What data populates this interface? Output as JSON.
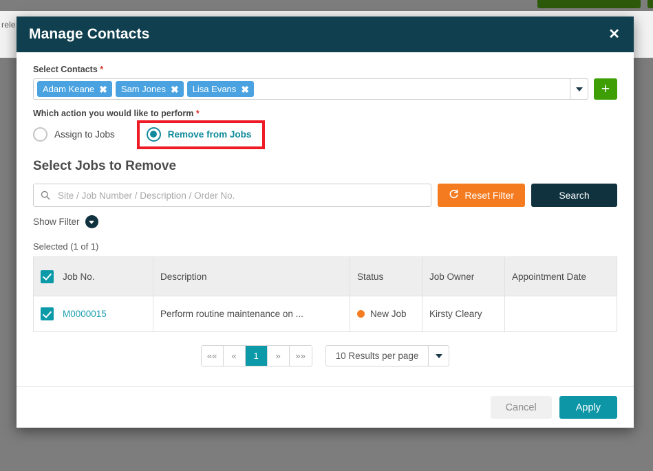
{
  "background": {
    "text_fragment": "rele",
    "green_button_color": "#2c5a0a",
    "overlay_color": "#7d7d7d"
  },
  "modal": {
    "title": "Manage Contacts",
    "header_color": "#10404f",
    "close_label": "✕"
  },
  "contacts": {
    "label": "Select Contacts",
    "required_marker": "*",
    "tags": [
      {
        "name": "Adam Keane",
        "remove_label": "✖"
      },
      {
        "name": "Sam Jones",
        "remove_label": "✖"
      },
      {
        "name": "Lisa Evans",
        "remove_label": "✖"
      }
    ],
    "add_button_label": "+",
    "tag_color": "#4aa3e0",
    "add_button_color": "#3d9e06"
  },
  "action": {
    "label": "Which action you would like to perform",
    "required_marker": "*",
    "options": [
      {
        "label": "Assign to Jobs",
        "selected": false
      },
      {
        "label": "Remove from Jobs",
        "selected": true
      }
    ],
    "selected_color": "#0c8a99",
    "highlight_color": "#ee1b24"
  },
  "jobs_section": {
    "title": "Select Jobs to Remove",
    "search": {
      "value": "",
      "placeholder": "Site / Job Number / Description / Order No.",
      "icon": "search-icon"
    },
    "reset_filter_label": "Reset Filter",
    "reset_filter_icon": "refresh-icon",
    "reset_filter_color": "#f57b20",
    "search_button_label": "Search",
    "search_button_color": "#10323f",
    "show_filter_label": "Show Filter",
    "show_filter_icon": "chevron-down-icon",
    "selected_count_label": "Selected (1 of 1)"
  },
  "table": {
    "columns": [
      "Job No.",
      "Description",
      "Status",
      "Job Owner",
      "Appointment Date"
    ],
    "header_select_all_checked": true,
    "rows": [
      {
        "checked": true,
        "job_no": "M0000015",
        "description": "Perform routine maintenance on ...",
        "status": "New Job",
        "status_color": "#f57b20",
        "job_owner": "Kirsty Cleary",
        "appointment_date": ""
      }
    ]
  },
  "pagination": {
    "first_label": "««",
    "prev_label": "«",
    "pages": [
      "1"
    ],
    "current_page": "1",
    "next_label": "»",
    "last_label": "»»",
    "per_page_label": "10 Results per page"
  },
  "footer": {
    "cancel_label": "Cancel",
    "apply_label": "Apply",
    "apply_color": "#0c96a6"
  }
}
